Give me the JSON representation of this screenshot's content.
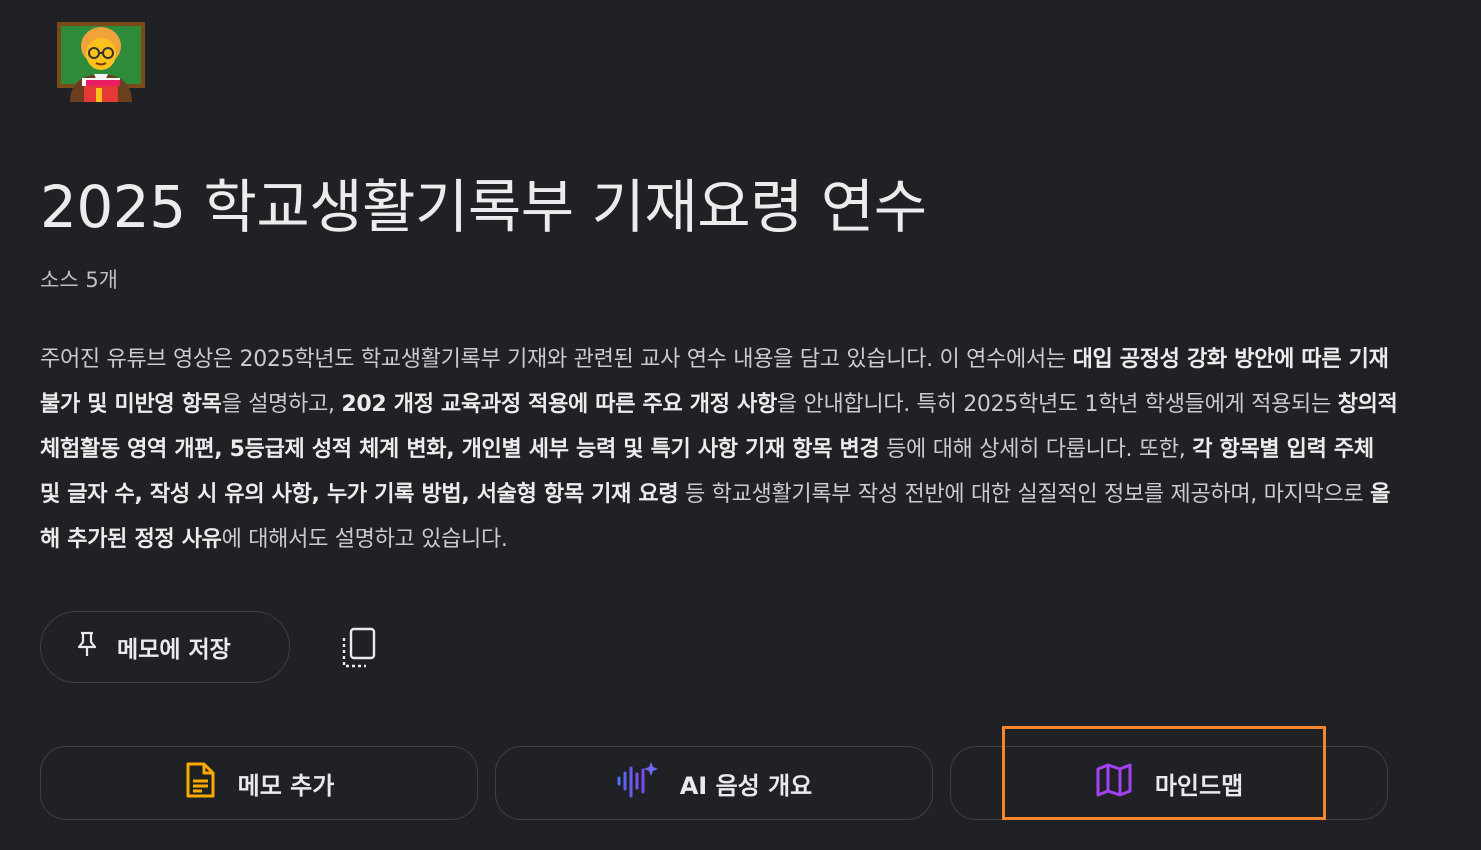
{
  "header": {
    "title": "2025 학교생활기록부 기재요령 연수",
    "source_count": "소스 5개"
  },
  "summary": {
    "s1": "주어진 유튜브 영상은 2025학년도 학교생활기록부 기재와 관련된 교사 연수 내용을 담고 있습니다. 이 연수에서는 ",
    "b1": "대입 공정성 강화 방안에 따른 기재 불가 및 미반영 항목",
    "s2": "을 설명하고, ",
    "b2": "202 개정 교육과정 적용에 따른 주요 개정 사항",
    "s3": "을 안내합니다. 특히 2025학년도 1학년 학생들에게 적용되는 ",
    "b3": "창의적 체험활동 영역 개편, 5등급제 성적 체계 변화, 개인별 세부 능력 및 특기 사항 기재 항목 변경",
    "s4": " 등에 대해 상세히 다룹니다. 또한, ",
    "b4": "각 항목별 입력 주체 및 글자 수, 작성 시 유의 사항, 누가 기록 방법, 서술형 항목 기재 요령",
    "s5": " 등 학교생활기록부 작성 전반에 대한 실질적인 정보를 제공하며, 마지막으로 ",
    "b5": "올해 추가된 정정 사유",
    "s6": "에 대해서도 설명하고 있습니다."
  },
  "actions": {
    "save_to_note": "메모에 저장",
    "add_note": "메모 추가",
    "audio_overview": "AI 음성 개요",
    "mind_map": "마인드맵"
  },
  "colors": {
    "background": "#202124",
    "note_icon": "#f9ab00",
    "audio_icon": "#4f6ef7",
    "mindmap_icon": "#a142f4",
    "highlight": "#f5862b"
  },
  "icons": {
    "emoji": "teacher-emoji-icon",
    "pin": "pin-icon",
    "copy": "copy-icon",
    "note": "note-icon",
    "audio": "audio-wave-icon",
    "mindmap": "map-icon"
  }
}
